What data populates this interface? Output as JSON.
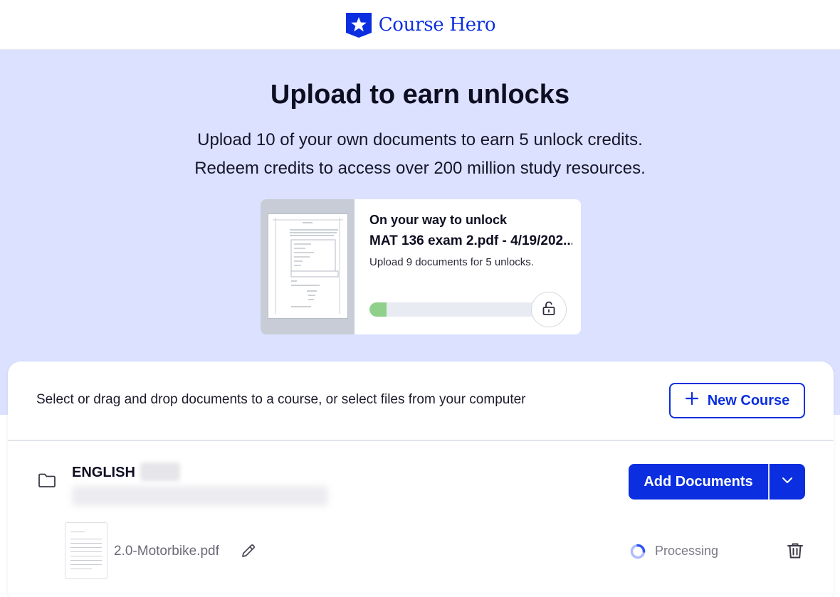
{
  "header": {
    "brand_name": "Course Hero"
  },
  "hero": {
    "title": "Upload to earn unlocks",
    "line1": "Upload 10 of your own documents to earn 5 unlock credits.",
    "line2": "Redeem credits to access over 200 million study resources."
  },
  "unlock_card": {
    "heading": "On your way to unlock",
    "file_title": "MAT 136 exam 2.pdf - 4/19/202...",
    "subtext": "Upload 9 documents for 5 unlocks.",
    "progress_fraction": 0.1,
    "progress_color": "#8fd08a"
  },
  "upload_panel": {
    "instructions": "Select or drag and drop documents to a course, or select files from your computer",
    "new_course_label": "New Course"
  },
  "course": {
    "name": "ENGLISH",
    "add_documents_label": "Add Documents",
    "files": [
      {
        "name": "2.0-Motorbike.pdf",
        "status": "Processing"
      }
    ]
  },
  "colors": {
    "brand_blue": "#0a2ee0",
    "hero_bg": "#dbe1ff"
  }
}
